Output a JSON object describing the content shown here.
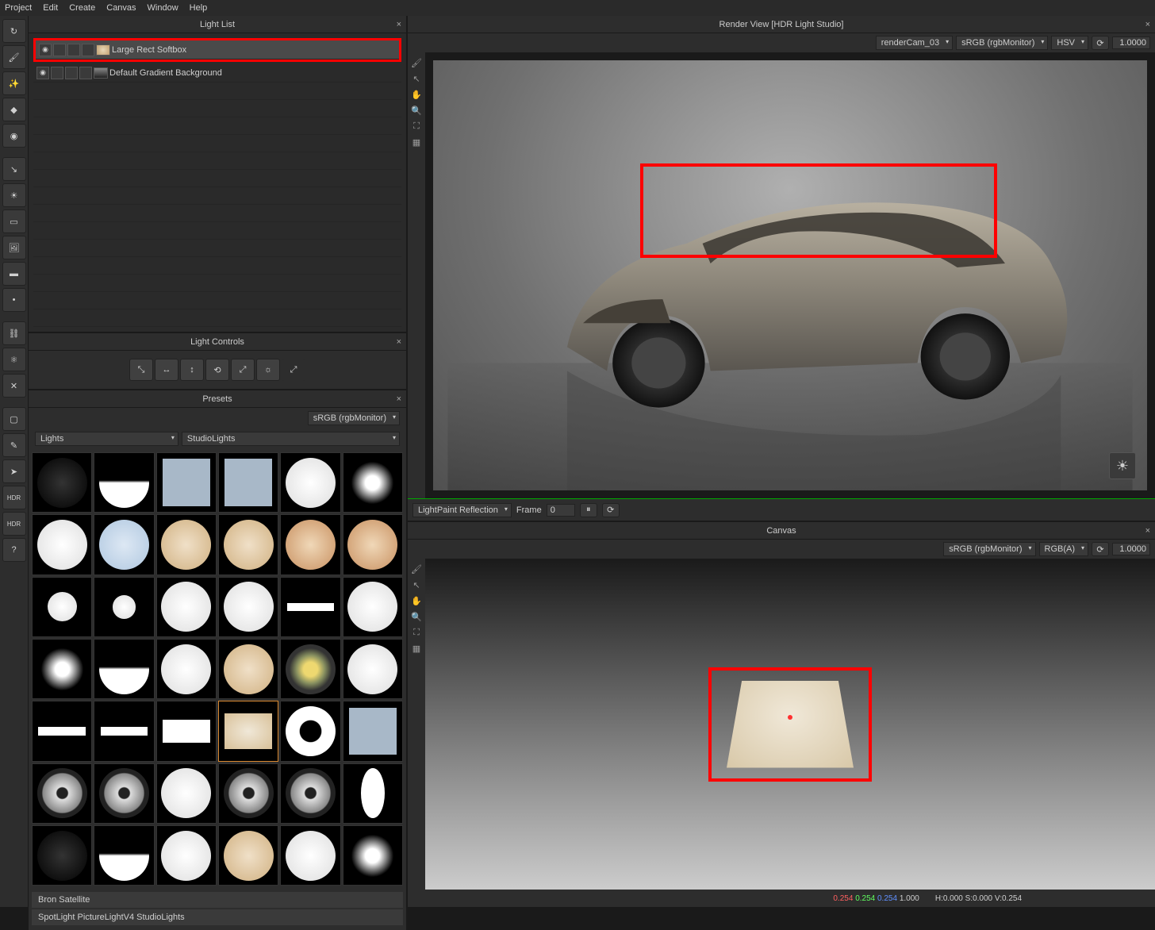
{
  "menu": {
    "items": [
      "Project",
      "Edit",
      "Create",
      "Canvas",
      "Window",
      "Help"
    ]
  },
  "panels": {
    "lightList": "Light List",
    "lightControls": "Light Controls",
    "presets": "Presets",
    "renderView": "Render View [HDR Light Studio]",
    "canvas": "Canvas"
  },
  "lights": [
    {
      "name": "Large Rect Softbox",
      "selected": true
    },
    {
      "name": "Default Gradient Background",
      "selected": false
    }
  ],
  "render": {
    "camera": "renderCam_03",
    "colorSpace": "sRGB (rgbMonitor)",
    "mode": "HSV",
    "value": "1.0000",
    "lightPaint": "LightPaint  Reflection",
    "frameLabel": "Frame",
    "frameValue": "0"
  },
  "canvas": {
    "colorSpace": "sRGB (rgbMonitor)",
    "mode": "RGB(A)",
    "value": "1.0000",
    "rgba": [
      "0.254",
      "0.254",
      "0.254",
      "1.000"
    ],
    "hsv": "H:0.000 S:0.000 V:0.254"
  },
  "presets": {
    "colorSpace": "sRGB (rgbMonitor)",
    "category": "Lights",
    "subcategory": "StudioLights",
    "footer1": "Bron Satellite",
    "footer2": "SpotLight PictureLightV4 StudioLights"
  }
}
